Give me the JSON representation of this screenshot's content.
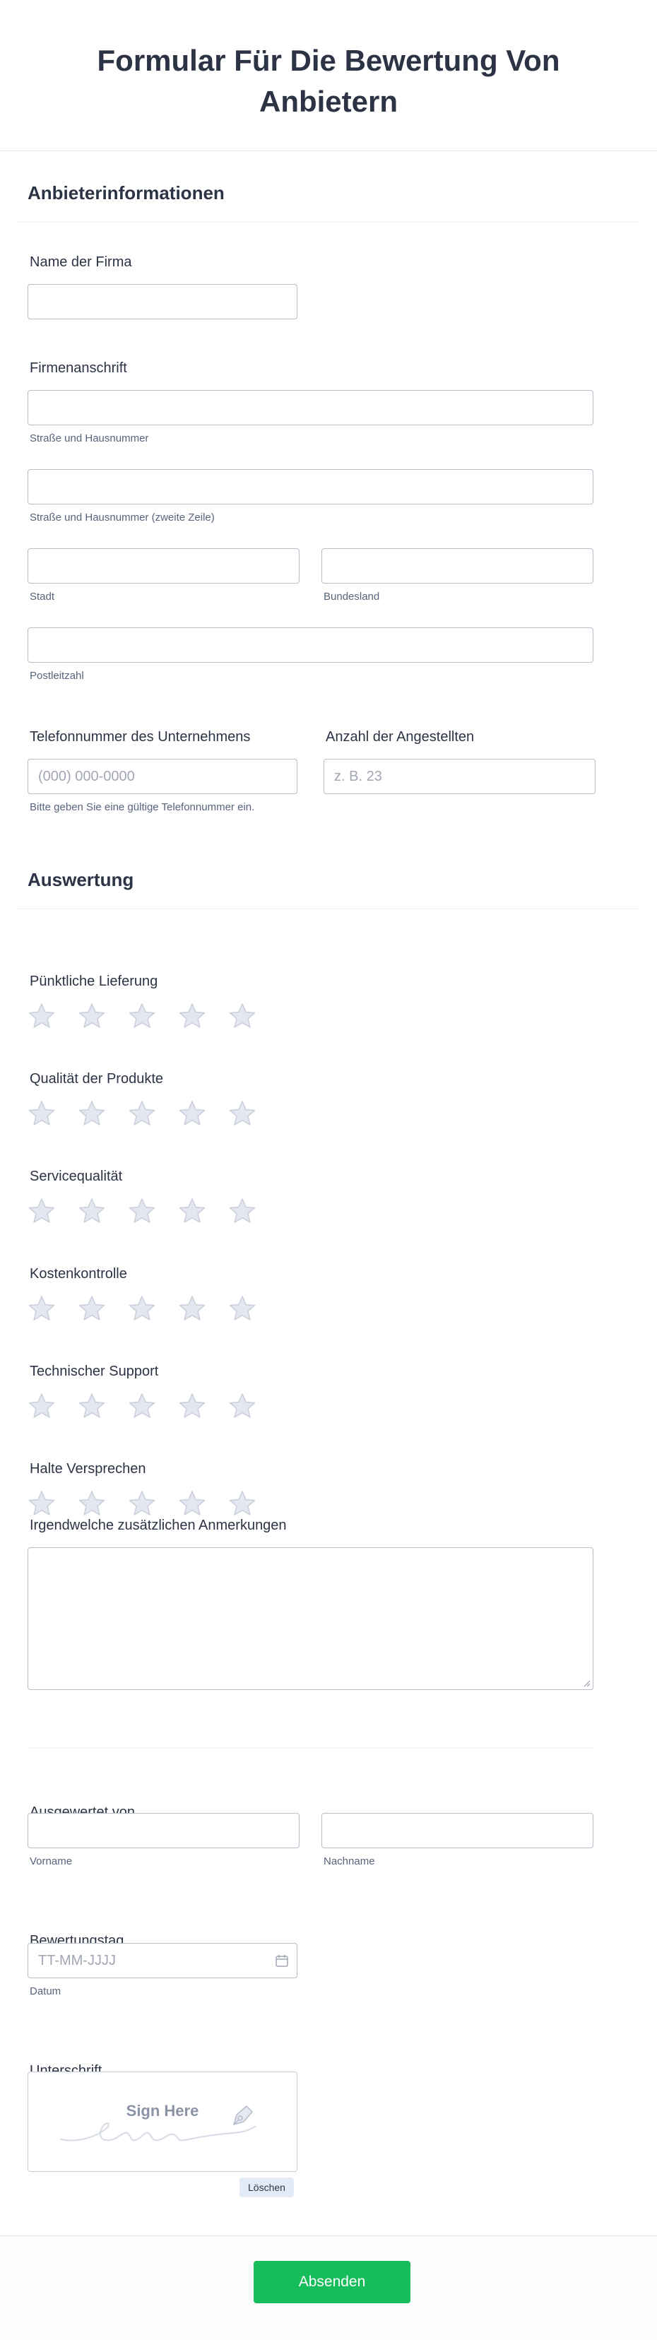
{
  "header": {
    "title": "Formular Für Die Bewertung Von Anbietern"
  },
  "vendor_section": {
    "title": "Anbieterinformationen",
    "company_name": {
      "label": "Name der Firma",
      "value": ""
    },
    "address": {
      "label": "Firmenanschrift",
      "street_sub": "Straße und Hausnummer",
      "street2_sub": "Straße und Hausnummer (zweite Zeile)",
      "city_sub": "Stadt",
      "state_sub": "Bundesland",
      "zip_sub": "Postleitzahl"
    },
    "phone": {
      "label": "Telefonnummer des Unternehmens",
      "placeholder": "(000) 000-0000",
      "hint": "Bitte geben Sie eine gültige Telefonnummer ein."
    },
    "employees": {
      "label": "Anzahl der Angestellten",
      "placeholder": "z. B. 23"
    }
  },
  "evaluation_section": {
    "title": "Auswertung",
    "ratings": [
      {
        "label": "Pünktliche Lieferung",
        "value": 0,
        "max": 5
      },
      {
        "label": "Qualität der Produkte",
        "value": 0,
        "max": 5
      },
      {
        "label": "Servicequalität",
        "value": 0,
        "max": 5
      },
      {
        "label": "Kostenkontrolle",
        "value": 0,
        "max": 5
      },
      {
        "label": "Technischer Support",
        "value": 0,
        "max": 5
      },
      {
        "label": "Halte Versprechen",
        "value": 0,
        "max": 5
      }
    ],
    "comments": {
      "label": "Irgendwelche zusätzlichen Anmerkungen",
      "value": ""
    }
  },
  "evaluator_section": {
    "evaluated_by": {
      "label": "Ausgewertet von",
      "first_sub": "Vorname",
      "last_sub": "Nachname"
    },
    "date": {
      "label": "Bewertungstag",
      "placeholder": "TT-MM-JJJJ",
      "sub": "Datum",
      "icon": "calendar-icon"
    },
    "signature": {
      "label": "Unterschrift",
      "pad_text": "Sign Here",
      "clear_label": "Löschen",
      "icon": "pen-nib-icon"
    }
  },
  "footer": {
    "submit_label": "Absenden"
  },
  "colors": {
    "accent": "#18bd5b",
    "text": "#2c3345",
    "star_fill": "#e4e7ef",
    "star_stroke": "#c9cedb"
  }
}
